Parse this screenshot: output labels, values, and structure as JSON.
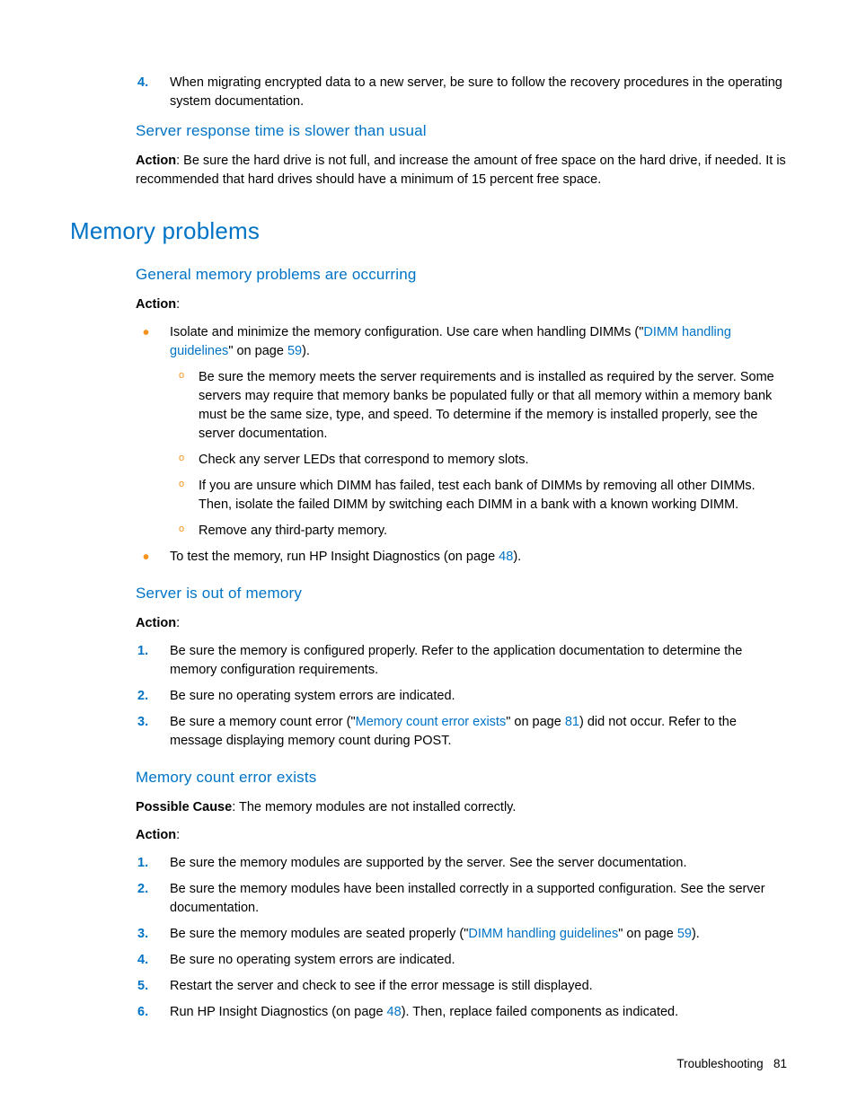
{
  "top_list": {
    "start": 3,
    "item4": "When migrating encrypted data to a new server, be sure to follow the recovery procedures in the operating system documentation."
  },
  "sec_response": {
    "title": "Server response time is slower than usual",
    "action_label": "Action",
    "action_text": ": Be sure the hard drive is not full, and increase the amount of free space on the hard drive, if needed. It is recommended that hard drives should have a minimum of 15 percent free space."
  },
  "sec_memory": {
    "title": "Memory problems"
  },
  "sec_general": {
    "title": "General memory problems are occurring",
    "action_label": "Action",
    "colon": ":",
    "b1_pre": "Isolate and minimize the memory configuration. Use care when handling DIMMs (\"",
    "b1_link": "DIMM handling guidelines",
    "b1_mid": "\" on page ",
    "b1_page": "59",
    "b1_post": ").",
    "s1": "Be sure the memory meets the server requirements and is installed as required by the server. Some servers may require that memory banks be populated fully or that all memory within a memory bank must be the same size, type, and speed. To determine if the memory is installed properly, see the server documentation.",
    "s2": "Check any server LEDs that correspond to memory slots.",
    "s3": "If you are unsure which DIMM has failed, test each bank of DIMMs by removing all other DIMMs. Then, isolate the failed DIMM by switching each DIMM in a bank with a known working DIMM.",
    "s4": "Remove any third-party memory.",
    "b2_pre": "To test the memory, run HP Insight Diagnostics (on page ",
    "b2_page": "48",
    "b2_post": ")."
  },
  "sec_outmem": {
    "title": "Server is out of memory",
    "action_label": "Action",
    "colon": ":",
    "i1": "Be sure the memory is configured properly. Refer to the application documentation to determine the memory configuration requirements.",
    "i2": "Be sure no operating system errors are indicated.",
    "i3_pre": "Be sure a memory count error (\"",
    "i3_link": "Memory count error exists",
    "i3_mid": "\" on page ",
    "i3_page": "81",
    "i3_post": ") did not occur. Refer to the message displaying memory count during POST."
  },
  "sec_memcount": {
    "title": "Memory count error exists",
    "cause_label": "Possible Cause",
    "cause_text": ": The memory modules are not installed correctly.",
    "action_label": "Action",
    "colon": ":",
    "i1": "Be sure the memory modules are supported by the server. See the server documentation.",
    "i2": "Be sure the memory modules have been installed correctly in a supported configuration. See the server documentation.",
    "i3_pre": "Be sure the memory modules are seated properly (\"",
    "i3_link": "DIMM handling guidelines",
    "i3_mid": "\" on page ",
    "i3_page": "59",
    "i3_post": ").",
    "i4": "Be sure no operating system errors are indicated.",
    "i5": "Restart the server and check to see if the error message is still displayed.",
    "i6_pre": "Run HP Insight Diagnostics (on page ",
    "i6_page": "48",
    "i6_post": "). Then, replace failed components as indicated."
  },
  "footer": {
    "section": "Troubleshooting",
    "page": "81"
  }
}
